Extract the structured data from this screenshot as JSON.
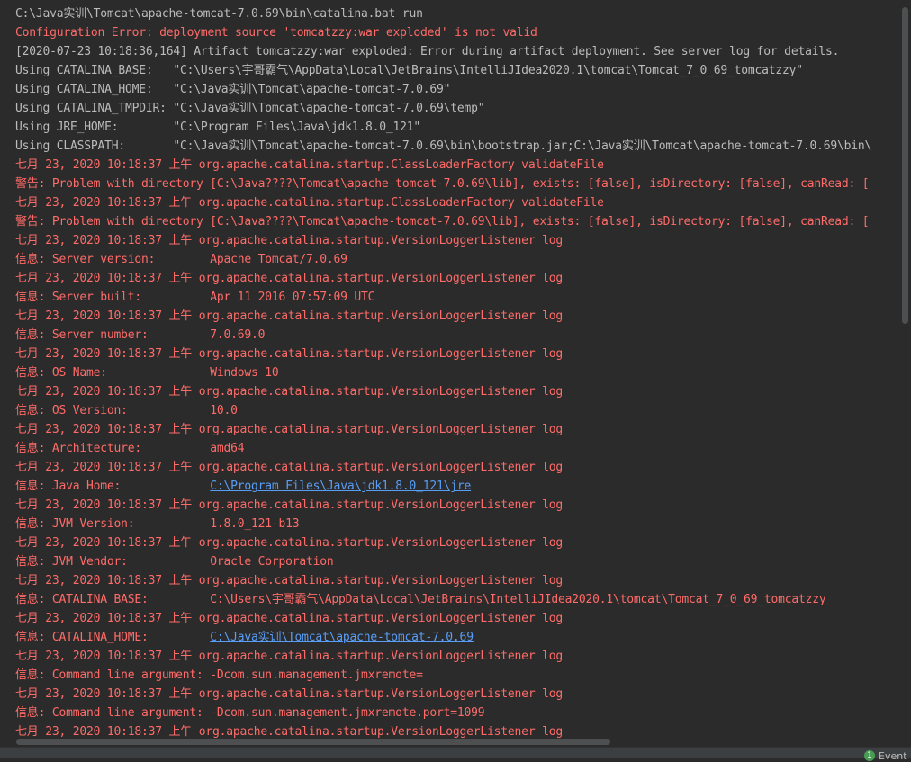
{
  "console": {
    "lines": [
      {
        "type": "plain",
        "text": "C:\\Java实训\\Tomcat\\apache-tomcat-7.0.69\\bin\\catalina.bat run"
      },
      {
        "type": "error",
        "text": "Configuration Error: deployment source 'tomcatzzy:war exploded' is not valid"
      },
      {
        "type": "plain",
        "text": "[2020-07-23 10:18:36,164] Artifact tomcatzzy:war exploded: Error during artifact deployment. See server log for details."
      },
      {
        "type": "plain",
        "text": "Using CATALINA_BASE:   \"C:\\Users\\宇哥霸气\\AppData\\Local\\JetBrains\\IntelliJIdea2020.1\\tomcat\\Tomcat_7_0_69_tomcatzzy\""
      },
      {
        "type": "plain",
        "text": "Using CATALINA_HOME:   \"C:\\Java实训\\Tomcat\\apache-tomcat-7.0.69\""
      },
      {
        "type": "plain",
        "text": "Using CATALINA_TMPDIR: \"C:\\Java实训\\Tomcat\\apache-tomcat-7.0.69\\temp\""
      },
      {
        "type": "plain",
        "text": "Using JRE_HOME:        \"C:\\Program Files\\Java\\jdk1.8.0_121\""
      },
      {
        "type": "plain",
        "text": "Using CLASSPATH:       \"C:\\Java实训\\Tomcat\\apache-tomcat-7.0.69\\bin\\bootstrap.jar;C:\\Java实训\\Tomcat\\apache-tomcat-7.0.69\\bin\\"
      },
      {
        "type": "error",
        "text": "七月 23, 2020 10:18:37 上午 org.apache.catalina.startup.ClassLoaderFactory validateFile"
      },
      {
        "type": "error",
        "text": "警告: Problem with directory [C:\\Java????\\Tomcat\\apache-tomcat-7.0.69\\lib], exists: [false], isDirectory: [false], canRead: ["
      },
      {
        "type": "error",
        "text": "七月 23, 2020 10:18:37 上午 org.apache.catalina.startup.ClassLoaderFactory validateFile"
      },
      {
        "type": "error",
        "text": "警告: Problem with directory [C:\\Java????\\Tomcat\\apache-tomcat-7.0.69\\lib], exists: [false], isDirectory: [false], canRead: ["
      },
      {
        "type": "error",
        "text": "七月 23, 2020 10:18:37 上午 org.apache.catalina.startup.VersionLoggerListener log"
      },
      {
        "type": "error",
        "text": "信息: Server version:        Apache Tomcat/7.0.69"
      },
      {
        "type": "error",
        "text": "七月 23, 2020 10:18:37 上午 org.apache.catalina.startup.VersionLoggerListener log"
      },
      {
        "type": "error",
        "text": "信息: Server built:          Apr 11 2016 07:57:09 UTC"
      },
      {
        "type": "error",
        "text": "七月 23, 2020 10:18:37 上午 org.apache.catalina.startup.VersionLoggerListener log"
      },
      {
        "type": "error",
        "text": "信息: Server number:         7.0.69.0"
      },
      {
        "type": "error",
        "text": "七月 23, 2020 10:18:37 上午 org.apache.catalina.startup.VersionLoggerListener log"
      },
      {
        "type": "error",
        "text": "信息: OS Name:               Windows 10"
      },
      {
        "type": "error",
        "text": "七月 23, 2020 10:18:37 上午 org.apache.catalina.startup.VersionLoggerListener log"
      },
      {
        "type": "error",
        "text": "信息: OS Version:            10.0"
      },
      {
        "type": "error",
        "text": "七月 23, 2020 10:18:37 上午 org.apache.catalina.startup.VersionLoggerListener log"
      },
      {
        "type": "error",
        "text": "信息: Architecture:          amd64"
      },
      {
        "type": "error",
        "text": "七月 23, 2020 10:18:37 上午 org.apache.catalina.startup.VersionLoggerListener log"
      },
      {
        "type": "error",
        "text": "信息: Java Home:             ",
        "link": "C:\\Program Files\\Java\\jdk1.8.0_121\\jre"
      },
      {
        "type": "error",
        "text": "七月 23, 2020 10:18:37 上午 org.apache.catalina.startup.VersionLoggerListener log"
      },
      {
        "type": "error",
        "text": "信息: JVM Version:           1.8.0_121-b13"
      },
      {
        "type": "error",
        "text": "七月 23, 2020 10:18:37 上午 org.apache.catalina.startup.VersionLoggerListener log"
      },
      {
        "type": "error",
        "text": "信息: JVM Vendor:            Oracle Corporation"
      },
      {
        "type": "error",
        "text": "七月 23, 2020 10:18:37 上午 org.apache.catalina.startup.VersionLoggerListener log"
      },
      {
        "type": "error",
        "text": "信息: CATALINA_BASE:         C:\\Users\\宇哥霸气\\AppData\\Local\\JetBrains\\IntelliJIdea2020.1\\tomcat\\Tomcat_7_0_69_tomcatzzy"
      },
      {
        "type": "error",
        "text": "七月 23, 2020 10:18:37 上午 org.apache.catalina.startup.VersionLoggerListener log"
      },
      {
        "type": "error",
        "text": "信息: CATALINA_HOME:         ",
        "link": "C:\\Java实训\\Tomcat\\apache-tomcat-7.0.69"
      },
      {
        "type": "error",
        "text": "七月 23, 2020 10:18:37 上午 org.apache.catalina.startup.VersionLoggerListener log"
      },
      {
        "type": "error",
        "text": "信息: Command line argument: -Dcom.sun.management.jmxremote="
      },
      {
        "type": "error",
        "text": "七月 23, 2020 10:18:37 上午 org.apache.catalina.startup.VersionLoggerListener log"
      },
      {
        "type": "error",
        "text": "信息: Command line argument: -Dcom.sun.management.jmxremote.port=1099"
      },
      {
        "type": "error",
        "text": "七月 23, 2020 10:18:37 上午 org.apache.catalina.startup.VersionLoggerListener log"
      }
    ]
  },
  "statusbar": {
    "event_log_badge": "1",
    "event_log_label": "Event Log"
  },
  "colors": {
    "background": "#2b2b2b",
    "plain_text": "#bbbbbb",
    "error_text": "#ff6b68",
    "link_text": "#589df6"
  }
}
